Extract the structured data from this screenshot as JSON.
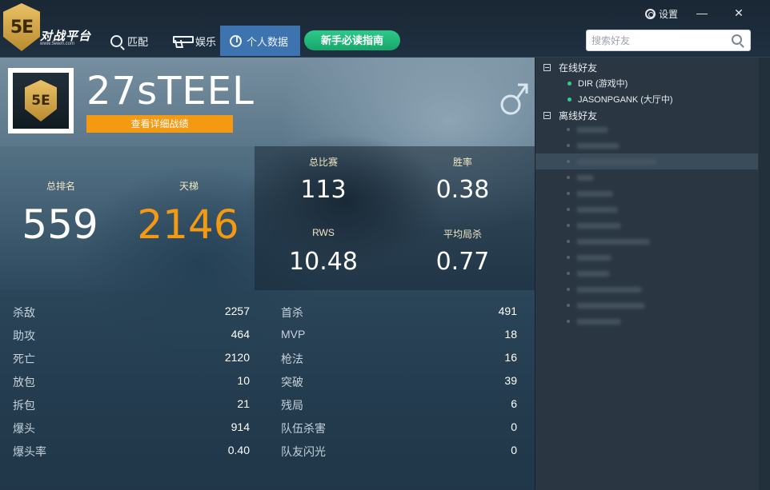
{
  "app": {
    "logo_title": "对战平台",
    "logo_url": "www.5ewin.com",
    "logo_mark": "5E",
    "settings_label": "设置",
    "minimize": "—",
    "close": "✕"
  },
  "nav": {
    "items": [
      {
        "label": "匹配",
        "icon": "search-icon"
      },
      {
        "label": "娱乐",
        "icon": "gun-icon"
      },
      {
        "label": "个人数据",
        "icon": "pie-chart-icon",
        "active": true
      }
    ],
    "guide_label": "新手必读指南"
  },
  "search": {
    "placeholder": "搜索好友"
  },
  "profile": {
    "username": "27sTEEL",
    "detail_button": "查看详细战绩",
    "avatar_mark": "5E",
    "gender": "male"
  },
  "summary": {
    "rank_label": "总排名",
    "rank_value": "559",
    "ladder_label": "天梯",
    "ladder_value": "2146",
    "matches_label": "总比赛",
    "matches_value": "113",
    "winrate_label": "胜率",
    "winrate_value": "0.38",
    "rws_label": "RWS",
    "rws_value": "10.48",
    "avgkill_label": "平均局杀",
    "avgkill_value": "0.77"
  },
  "stats_left": [
    {
      "label": "杀敌",
      "value": "2257"
    },
    {
      "label": "助攻",
      "value": "464"
    },
    {
      "label": "死亡",
      "value": "2120"
    },
    {
      "label": "放包",
      "value": "10"
    },
    {
      "label": "拆包",
      "value": "21"
    },
    {
      "label": "爆头",
      "value": "914"
    },
    {
      "label": "爆头率",
      "value": "0.40"
    }
  ],
  "stats_right": [
    {
      "label": "首杀",
      "value": "491"
    },
    {
      "label": "MVP",
      "value": "18"
    },
    {
      "label": "枪法",
      "value": "16"
    },
    {
      "label": "突破",
      "value": "39"
    },
    {
      "label": "残局",
      "value": "6"
    },
    {
      "label": "队伍杀害",
      "value": "0"
    },
    {
      "label": "队友闪光",
      "value": "0"
    }
  ],
  "friends": {
    "online_label": "在线好友",
    "offline_label": "离线好友",
    "online": [
      {
        "name": "DIR (游戏中)"
      },
      {
        "name": "JASONPGANK (大厅中)"
      }
    ]
  },
  "colors": {
    "accent_orange": "#f39a12",
    "guide_green": "#1fb878",
    "nav_active": "#3d74b0",
    "online_dot": "#2fd18a"
  }
}
